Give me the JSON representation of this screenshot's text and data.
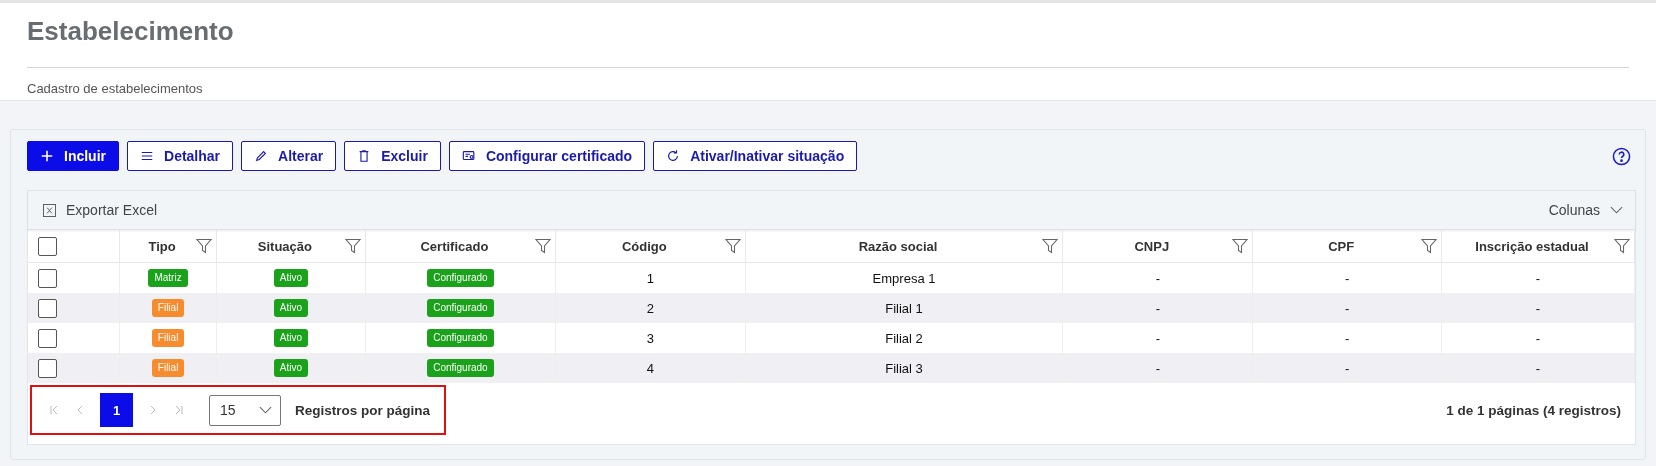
{
  "header": {
    "title": "Estabelecimento",
    "subtitle": "Cadastro de estabelecimentos"
  },
  "toolbar": [
    {
      "label": "Incluir",
      "primary": true
    },
    {
      "label": "Detalhar",
      "primary": false
    },
    {
      "label": "Alterar",
      "primary": false
    },
    {
      "label": "Excluir",
      "primary": false
    },
    {
      "label": "Configurar certificado",
      "primary": false
    },
    {
      "label": "Ativar/Inativar situação",
      "primary": false
    }
  ],
  "grid_bar": {
    "export": "Exportar Excel",
    "columns_menu": "Colunas"
  },
  "table": {
    "header_checkbox": {
      "checked": false
    },
    "columns": [
      {
        "label": "Tipo"
      },
      {
        "label": "Situação"
      },
      {
        "label": "Certificado"
      },
      {
        "label": "Código"
      },
      {
        "label": "Razão social"
      },
      {
        "label": "CNPJ"
      },
      {
        "label": "CPF"
      },
      {
        "label": "Inscrição estadual"
      }
    ],
    "rows": [
      {
        "checked": false,
        "tipo": {
          "label": "Matriz",
          "color": "#1aa31a"
        },
        "situacao": {
          "label": "Ativo",
          "color": "#1aa31a"
        },
        "certificado": {
          "label": "Configurado",
          "color": "#1aa31a"
        },
        "codigo": "1",
        "razao_social": "Empresa 1",
        "cnpj": "-",
        "cpf": "-",
        "inscricao_estadual": "-"
      },
      {
        "checked": false,
        "tipo": {
          "label": "Filial",
          "color": "#f78c2e"
        },
        "situacao": {
          "label": "Ativo",
          "color": "#1aa31a"
        },
        "certificado": {
          "label": "Configurado",
          "color": "#1aa31a"
        },
        "codigo": "2",
        "razao_social": "Filial 1",
        "cnpj": "-",
        "cpf": "-",
        "inscricao_estadual": "-"
      },
      {
        "checked": false,
        "tipo": {
          "label": "Filial",
          "color": "#f78c2e"
        },
        "situacao": {
          "label": "Ativo",
          "color": "#1aa31a"
        },
        "certificado": {
          "label": "Configurado",
          "color": "#1aa31a"
        },
        "codigo": "3",
        "razao_social": "Filial 2",
        "cnpj": "-",
        "cpf": "-",
        "inscricao_estadual": "-"
      },
      {
        "checked": false,
        "tipo": {
          "label": "Filial",
          "color": "#f78c2e"
        },
        "situacao": {
          "label": "Ativo",
          "color": "#1aa31a"
        },
        "certificado": {
          "label": "Configurado",
          "color": "#1aa31a"
        },
        "codigo": "4",
        "razao_social": "Filial 3",
        "cnpj": "-",
        "cpf": "-",
        "inscricao_estadual": "-"
      }
    ]
  },
  "pagination": {
    "first_disabled": true,
    "prev_disabled": true,
    "next_disabled": true,
    "last_disabled": true,
    "pages": [
      {
        "label": "1",
        "selected": true
      }
    ],
    "page_size": "15",
    "page_size_label": "Registros por página",
    "summary": "1 de 1 páginas (4 registros)",
    "highlighted": true
  }
}
